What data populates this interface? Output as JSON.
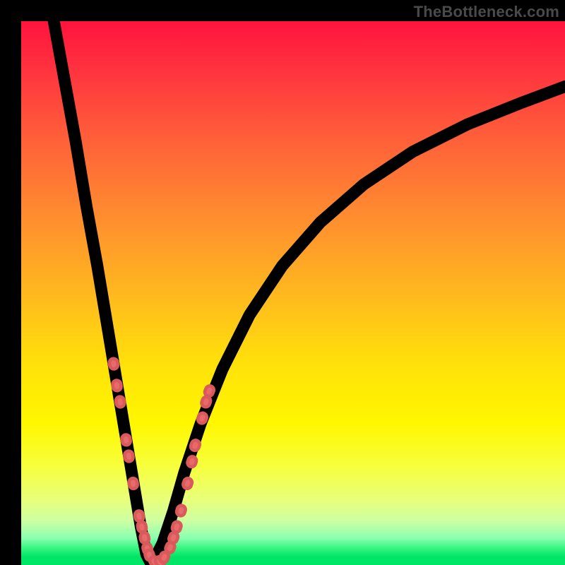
{
  "watermark": "TheBottleneck.com",
  "colors": {
    "bead": "#e86a6a",
    "curve": "#000000"
  },
  "chart_data": {
    "type": "line",
    "title": "",
    "xlabel": "",
    "ylabel": "",
    "x_range": [
      0,
      100
    ],
    "y_range": [
      0,
      100
    ],
    "note": "Axes unlabeled; values estimated from pixel positions on a 0–100 normalized grid. Curve is a V-shaped bottleneck profile with minimum near x≈24, y≈0.",
    "series": [
      {
        "name": "left-branch",
        "x": [
          6,
          8,
          10,
          12,
          14,
          16,
          17,
          18,
          19,
          20,
          21,
          22,
          23,
          24
        ],
        "y": [
          100,
          89,
          78,
          66,
          55,
          43,
          37,
          31,
          25,
          19,
          13,
          7,
          2,
          0
        ]
      },
      {
        "name": "right-branch",
        "x": [
          24,
          26,
          28,
          30,
          33,
          37,
          42,
          48,
          55,
          63,
          72,
          82,
          92,
          100
        ],
        "y": [
          0,
          4,
          10,
          17,
          26,
          36,
          46,
          55,
          63,
          70,
          76,
          81,
          85,
          88
        ]
      }
    ],
    "beads": {
      "note": "Highlighted sample markers along the curve (salmon capsules)",
      "points": [
        {
          "x": 17.0,
          "y": 37
        },
        {
          "x": 17.6,
          "y": 33
        },
        {
          "x": 18.2,
          "y": 30
        },
        {
          "x": 19.3,
          "y": 23
        },
        {
          "x": 19.8,
          "y": 20
        },
        {
          "x": 20.6,
          "y": 15
        },
        {
          "x": 21.7,
          "y": 9
        },
        {
          "x": 22.2,
          "y": 7
        },
        {
          "x": 22.7,
          "y": 5
        },
        {
          "x": 23.2,
          "y": 3
        },
        {
          "x": 23.6,
          "y": 1.8
        },
        {
          "x": 24.5,
          "y": 0.6
        },
        {
          "x": 25.5,
          "y": 0.6
        },
        {
          "x": 26.3,
          "y": 1.4
        },
        {
          "x": 27.4,
          "y": 3.2
        },
        {
          "x": 28.0,
          "y": 5
        },
        {
          "x": 28.6,
          "y": 7
        },
        {
          "x": 29.4,
          "y": 10
        },
        {
          "x": 30.6,
          "y": 15
        },
        {
          "x": 31.4,
          "y": 19
        },
        {
          "x": 32.0,
          "y": 22
        },
        {
          "x": 33.3,
          "y": 27
        },
        {
          "x": 34.0,
          "y": 30
        },
        {
          "x": 34.6,
          "y": 32
        }
      ]
    }
  }
}
